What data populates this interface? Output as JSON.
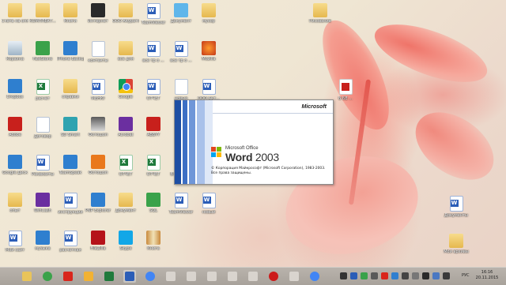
{
  "desktop_icons": [
    {
      "label": "Счета на оплату\n2015",
      "kind": "folder"
    },
    {
      "label": "КОМПЛЕКТ...",
      "kind": "folder"
    },
    {
      "label": "Книги",
      "kind": "folder"
    },
    {
      "label": "Интернет",
      "kind": "dark"
    },
    {
      "label": "ООО Акуратные\nДокументы",
      "kind": "folder"
    },
    {
      "label": "TeamViewer\nQuickSupport",
      "kind": "word"
    },
    {
      "label": "Документ",
      "kind": "lightblue"
    },
    {
      "label": "мусор",
      "kind": "folder"
    },
    {
      "label": "Корзина",
      "kind": "recycle"
    },
    {
      "label": "FastStone\nCapture",
      "kind": "green"
    },
    {
      "label": "iPhone Backup",
      "kind": "blue"
    },
    {
      "label": "контакты",
      "kind": "doc"
    },
    {
      "label": "все для\nвведения",
      "kind": "folder"
    },
    {
      "label": "все тр о ...",
      "kind": "word"
    },
    {
      "label": "все тр о ...",
      "kind": "word"
    },
    {
      "label": "Mozilla\nFirefox",
      "kind": "mozilla"
    },
    {
      "label": "Dropbox",
      "kind": "blue"
    },
    {
      "label": "расчет\nзарплат",
      "kind": "excel"
    },
    {
      "label": "справки",
      "kind": "folder"
    },
    {
      "label": "МЕНЮ\nПЕРЕВОД...",
      "kind": "word"
    },
    {
      "label": "Google\nChrome",
      "kind": "chrome"
    },
    {
      "label": "ОТЧЕТ\nАКТОВ ...",
      "kind": "word"
    },
    {
      "label": "новые\nдокументы",
      "kind": "doc"
    },
    {
      "label": "ООО Акт...",
      "kind": "word"
    },
    {
      "label": "Adobe\nReader XI",
      "kind": "red"
    },
    {
      "label": "Договор\nжилого\nпомещения",
      "kind": "doc"
    },
    {
      "label": "SD Smart\nStudio 3.0",
      "kind": "teal"
    },
    {
      "label": "Фотошоп\nкурсы",
      "kind": "pen"
    },
    {
      "label": "Acrobat\nAdobe Reader",
      "kind": "purple"
    },
    {
      "label": "ABBYY\nFineReader",
      "kind": "red"
    },
    {
      "label": "",
      "kind": "none"
    },
    {
      "label": "",
      "kind": "none"
    },
    {
      "label": "Google Диск",
      "kind": "blue"
    },
    {
      "label": "Реквизиты\nкарты",
      "kind": "word"
    },
    {
      "label": "TeamSpeak",
      "kind": "blue"
    },
    {
      "label": "Фотошоп",
      "kind": "orange"
    },
    {
      "label": "ОТЧЕТ\nАКТОВ ...",
      "kind": "excel"
    },
    {
      "label": "ОТЧЕТ\nАКТОВ ...",
      "kind": "excel"
    },
    {
      "label": "Входящий\nдокумент",
      "kind": "doc"
    },
    {
      "label": "ОТЧЕТ\nПРИНЯТИЯ",
      "kind": "word"
    },
    {
      "label": "опыт",
      "kind": "folder"
    },
    {
      "label": "WinCash\nmark",
      "kind": "purple"
    },
    {
      "label": "инструкции",
      "kind": "word"
    },
    {
      "label": "PNP Explorer",
      "kind": "blue"
    },
    {
      "label": "Документ",
      "kind": "folder"
    },
    {
      "label": "SQL\nManagement",
      "kind": "green"
    },
    {
      "label": "TeamViewer\nQuickSupport",
      "kind": "word"
    },
    {
      "label": "новый",
      "kind": "word"
    },
    {
      "label": "Мой сайт\nДокументы",
      "kind": "word"
    },
    {
      "label": "музыка",
      "kind": "blue"
    },
    {
      "label": "расчетная\nвыписка",
      "kind": "word"
    },
    {
      "label": "FileZilla",
      "kind": "filezilla"
    },
    {
      "label": "Skype",
      "kind": "skype"
    },
    {
      "label": "Книга",
      "kind": "book"
    }
  ],
  "right_icons": [
    {
      "label": "Рисование",
      "kind": "folder"
    },
    {
      "label": "Б БЕ ...",
      "kind": "pdf"
    },
    {
      "label": "Документы\nМои ...",
      "kind": "word"
    },
    {
      "label": "Мои архивы",
      "kind": "folder"
    }
  ],
  "splash": {
    "brand": "Microsoft",
    "suite": "Microsoft Office",
    "product": "Word",
    "version": "2003",
    "copyright": "© Корпорация Майкрософт (Microsoft Corporation), 1983-2003.",
    "rights": "Все права защищены."
  },
  "taskbar": {
    "items": [
      "file-explorer-icon",
      "browser-icon",
      "antivirus-icon",
      "messenger-icon",
      "excel-icon",
      "word-icon",
      "chrome-icon",
      "task-icon",
      "task-icon",
      "task-icon",
      "task-icon",
      "task-icon",
      "opera-icon",
      "task-icon",
      "chrome-icon"
    ],
    "language": "РУС",
    "time": "16:16",
    "date": "20.11.2015"
  }
}
